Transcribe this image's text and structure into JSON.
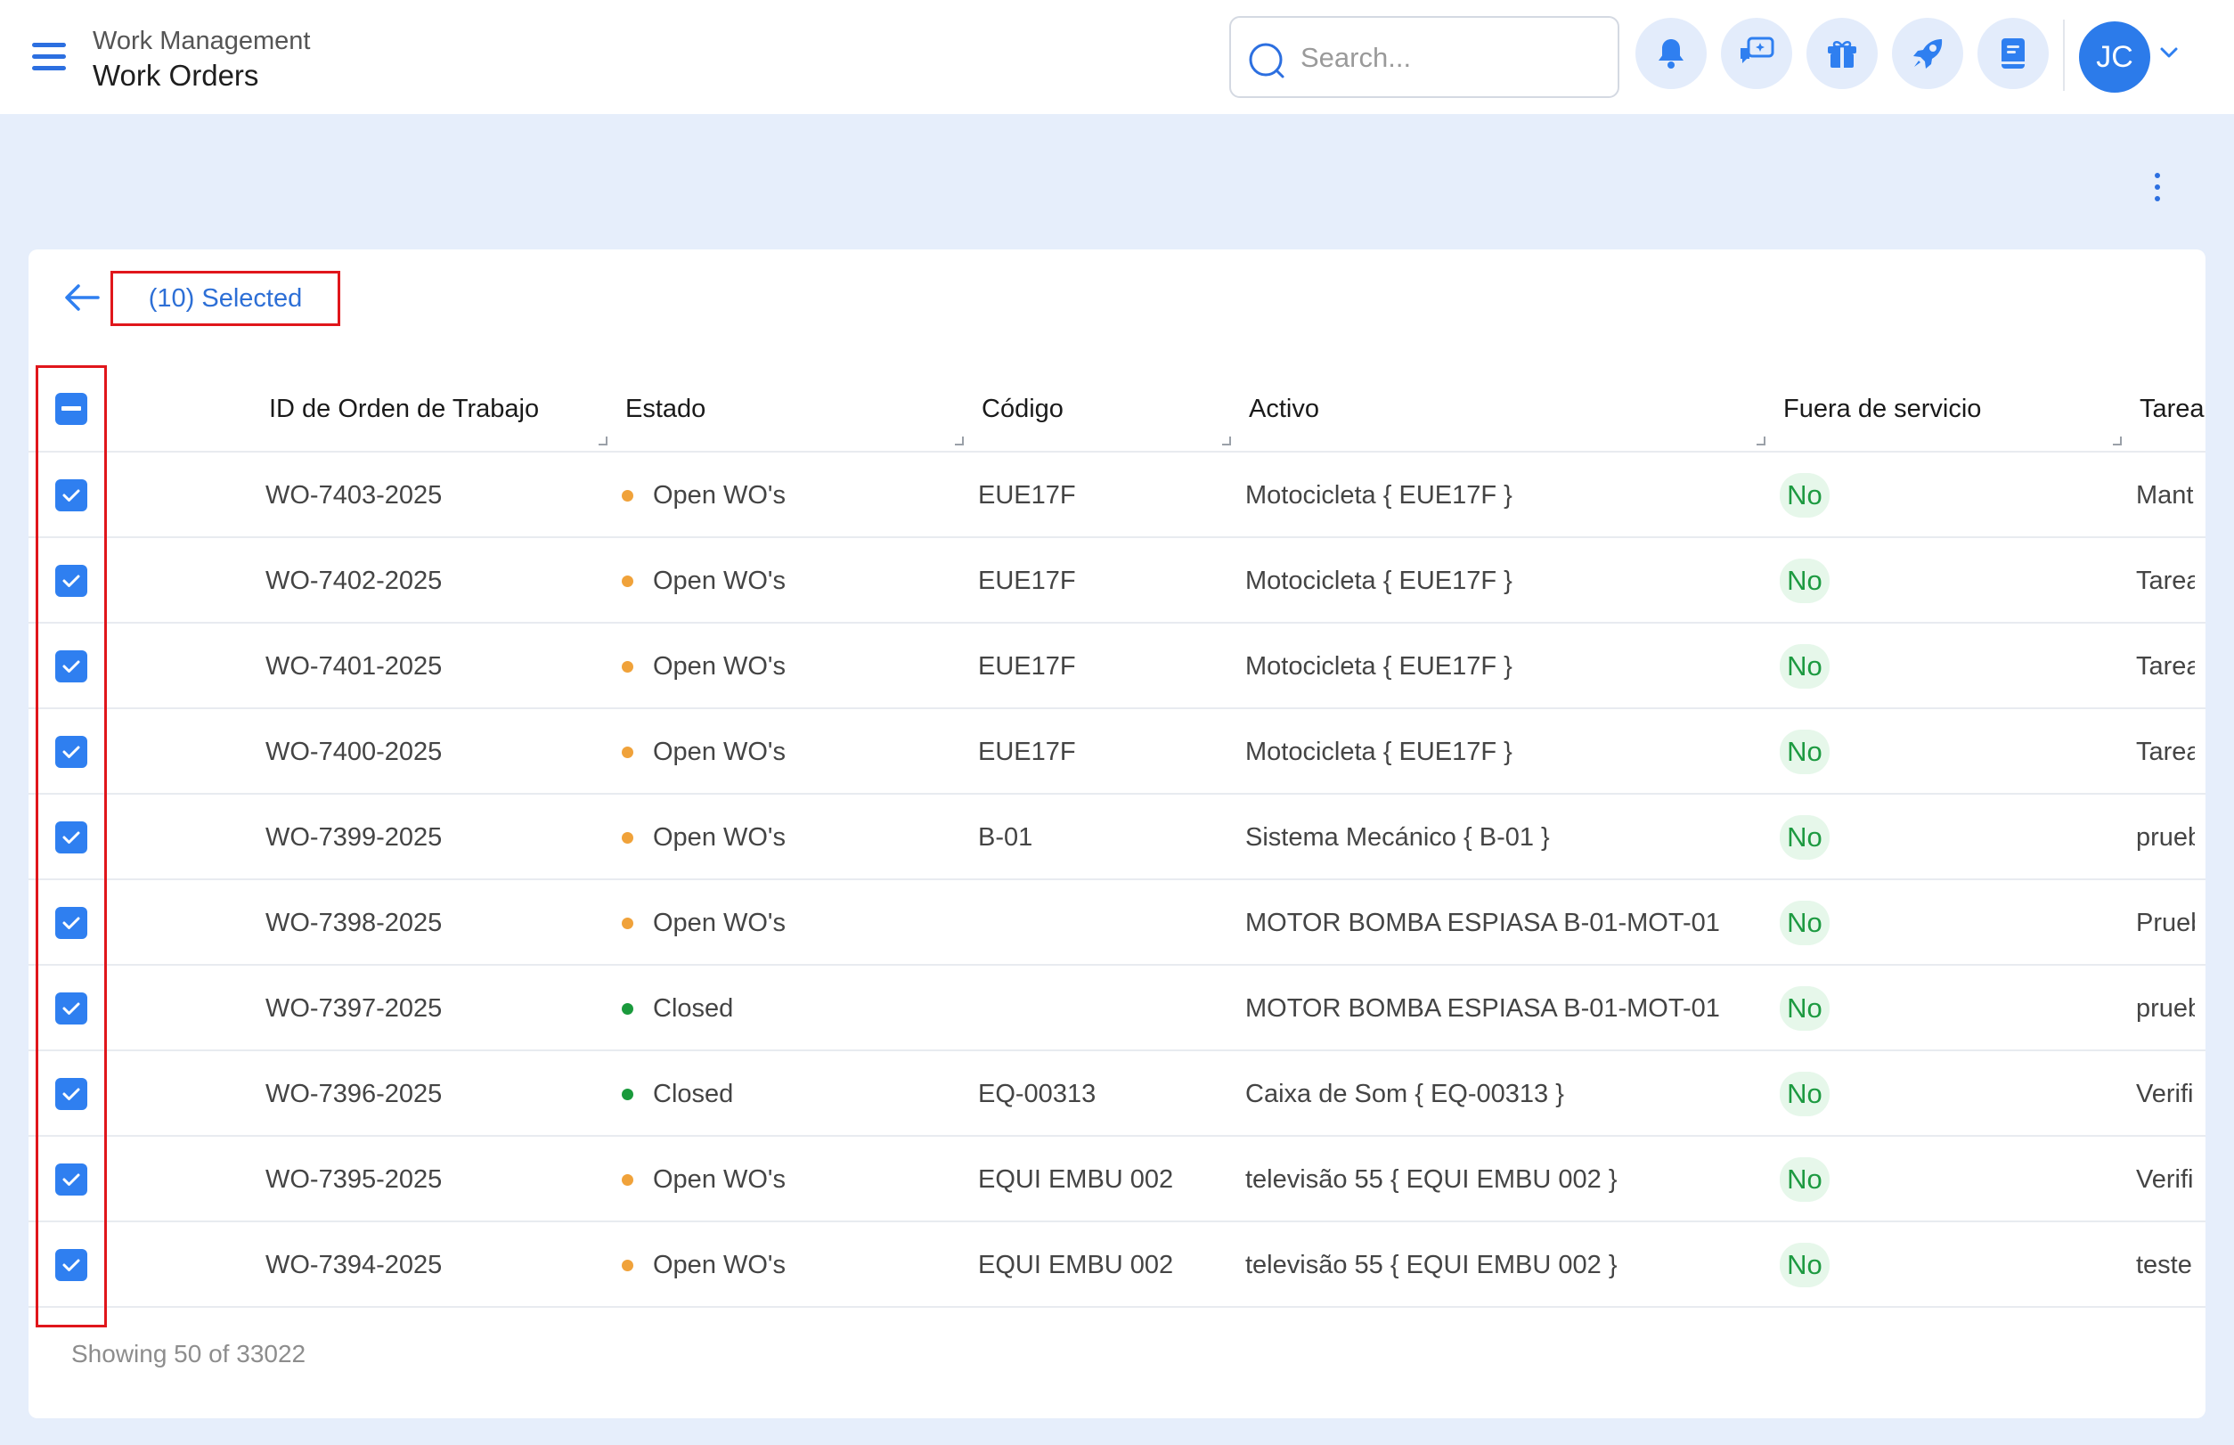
{
  "header": {
    "breadcrumb_parent": "Work Management",
    "page_title": "Work Orders",
    "search_placeholder": "Search...",
    "avatar_initials": "JC"
  },
  "toolbar": {
    "selected_label": "(10) Selected"
  },
  "table": {
    "columns": [
      "ID de Orden de Trabajo",
      "Estado",
      "Código",
      "Activo",
      "Fuera de servicio",
      "Tarea"
    ],
    "rows": [
      {
        "id": "WO-7403-2025",
        "status": "Open WO's",
        "status_color": "#f0a23a",
        "code": "EUE17F",
        "asset": "Motocicleta { EUE17F }",
        "out_of_service": "No",
        "task": "Mant"
      },
      {
        "id": "WO-7402-2025",
        "status": "Open WO's",
        "status_color": "#f0a23a",
        "code": "EUE17F",
        "asset": "Motocicleta { EUE17F }",
        "out_of_service": "No",
        "task": "Tarea"
      },
      {
        "id": "WO-7401-2025",
        "status": "Open WO's",
        "status_color": "#f0a23a",
        "code": "EUE17F",
        "asset": "Motocicleta { EUE17F }",
        "out_of_service": "No",
        "task": "Tarea"
      },
      {
        "id": "WO-7400-2025",
        "status": "Open WO's",
        "status_color": "#f0a23a",
        "code": "EUE17F",
        "asset": "Motocicleta { EUE17F }",
        "out_of_service": "No",
        "task": "Tarea"
      },
      {
        "id": "WO-7399-2025",
        "status": "Open WO's",
        "status_color": "#f0a23a",
        "code": "B-01",
        "asset": "Sistema Mecánico { B-01 }",
        "out_of_service": "No",
        "task": "prueb"
      },
      {
        "id": "WO-7398-2025",
        "status": "Open WO's",
        "status_color": "#f0a23a",
        "code": "",
        "asset": "MOTOR BOMBA ESPIASA B-01-MOT-01",
        "out_of_service": "No",
        "task": "Prueb"
      },
      {
        "id": "WO-7397-2025",
        "status": "Closed",
        "status_color": "#1a9a3c",
        "code": "",
        "asset": "MOTOR BOMBA ESPIASA B-01-MOT-01",
        "out_of_service": "No",
        "task": "prueb"
      },
      {
        "id": "WO-7396-2025",
        "status": "Closed",
        "status_color": "#1a9a3c",
        "code": "EQ-00313",
        "asset": "Caixa de Som { EQ-00313 }",
        "out_of_service": "No",
        "task": "Verifi"
      },
      {
        "id": "WO-7395-2025",
        "status": "Open WO's",
        "status_color": "#f0a23a",
        "code": "EQUI EMBU 002",
        "asset": "televisão 55 { EQUI EMBU 002 }",
        "out_of_service": "No",
        "task": "Verifi"
      },
      {
        "id": "WO-7394-2025",
        "status": "Open WO's",
        "status_color": "#f0a23a",
        "code": "EQUI EMBU 002",
        "asset": "televisão 55 { EQUI EMBU 002 }",
        "out_of_service": "No",
        "task": "teste"
      }
    ]
  },
  "footer": {
    "showing_text": "Showing 50 of 33022"
  },
  "colors": {
    "accent": "#2f7ff0",
    "highlight": "#e0161b",
    "page_bg": "#e6eefb"
  },
  "icons": [
    "menu-icon",
    "search-icon",
    "bell-icon",
    "chat-icon",
    "gift-icon",
    "rocket-icon",
    "book-icon",
    "chevron-down-icon",
    "more-vertical-icon",
    "arrow-left-icon",
    "checkbox-indeterminate-icon",
    "checkbox-checked-icon"
  ]
}
